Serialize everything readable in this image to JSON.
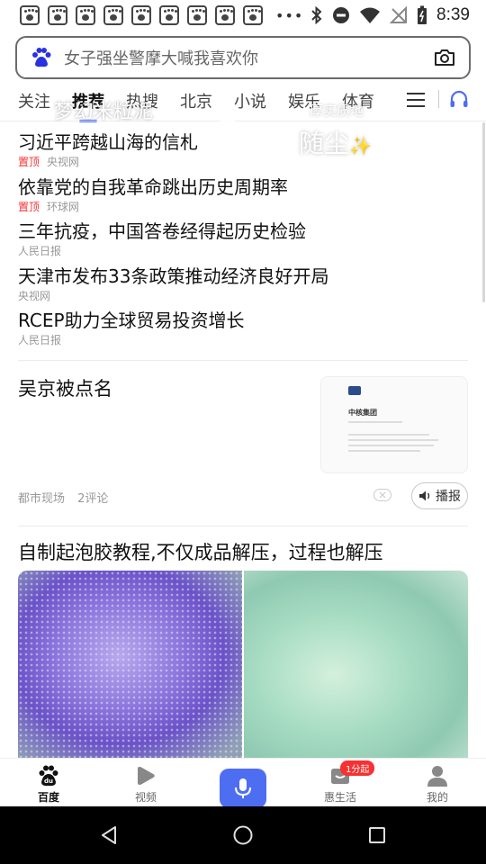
{
  "status_bar": {
    "time": "8:39",
    "notification_icons": [
      "baidu-icon",
      "baidu-icon",
      "baidu-icon",
      "baidu-icon",
      "baidu-icon",
      "baidu-icon",
      "baidu-icon",
      "baidu-icon",
      "baidu-icon"
    ],
    "more": "•••"
  },
  "search": {
    "query": "女子强坐警摩大喊我喜欢你"
  },
  "tabs": [
    "关注",
    "推荐",
    "热搜",
    "北京",
    "小说",
    "娱乐",
    "体育"
  ],
  "active_tab": "推荐",
  "hot_list": [
    {
      "title": "习近平跨越山海的信札",
      "pin": "置顶",
      "source": "央视网"
    },
    {
      "title": "依靠党的自我革命跳出历史周期率",
      "pin": "置顶",
      "source": "环球网"
    },
    {
      "title": "三年抗疫，中国答卷经得起历史检验",
      "pin": "",
      "source": "人民日报"
    },
    {
      "title": "天津市发布33条政策推动经济良好开局",
      "pin": "",
      "source": "央视网"
    },
    {
      "title": "RCEP助力全球贸易投资增长",
      "pin": "",
      "source": "人民日报"
    }
  ],
  "article1": {
    "title": "吴京被点名",
    "source": "都市现场",
    "comments": "2评论",
    "play_label": "播报",
    "thumb_heading": "中核集团"
  },
  "article2": {
    "title": "自制起泡胶教程,不仅成品解压，过程也解压",
    "caption_left": "梦幻米粒泥",
    "caption_right_small": "厚实质地",
    "caption_right": "随尘",
    "sparkle": "✨"
  },
  "bottom_nav": {
    "home": "百度",
    "video": "视频",
    "life": "惠生活",
    "life_badge": "1分起",
    "mine": "我的"
  },
  "colors": {
    "accent": "#4e6ef2",
    "pin_red": "#f73131"
  }
}
